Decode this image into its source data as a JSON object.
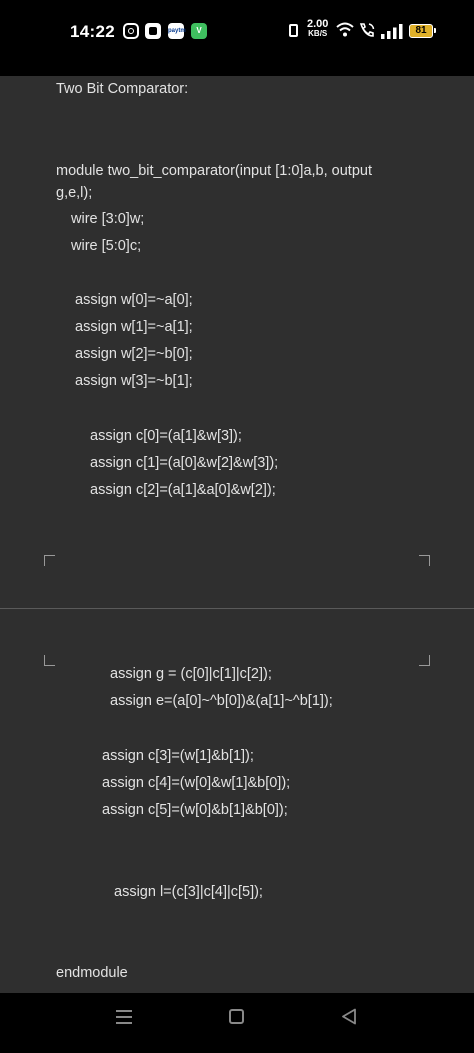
{
  "status_bar": {
    "time": "14:22",
    "app2_label": "paytm",
    "app3_label": "V",
    "net_speed_value": "2.00",
    "net_speed_unit": "KB/S",
    "battery_level": "81",
    "battery_color": "#e0b12a"
  },
  "document": {
    "title": "Two Bit Comparator:",
    "lines": [
      "module two_bit_comparator(input [1:0]a,b, output",
      "g,e,l);",
      "wire [3:0]w;",
      "wire [5:0]c;",
      "assign w[0]=~a[0];",
      "assign w[1]=~a[1];",
      "assign w[2]=~b[0];",
      "assign w[3]=~b[1];",
      "assign c[0]=(a[1]&w[3]);",
      "assign c[1]=(a[0]&w[2]&w[3]);",
      "assign c[2]=(a[1]&a[0]&w[2]);",
      "assign g = (c[0]|c[1]|c[2]);",
      "assign e=(a[0]~^b[0])&(a[1]~^b[1]);",
      "assign c[3]=(w[1]&b[1]);",
      "assign c[4]=(w[0]&w[1]&b[0]);",
      "assign c[5]=(w[0]&b[1]&b[0]);",
      "assign l=(c[3]|c[4]|c[5]);",
      "endmodule"
    ]
  },
  "nav_bar": {
    "icons": [
      "menu-icon",
      "home-icon",
      "back-icon"
    ]
  }
}
